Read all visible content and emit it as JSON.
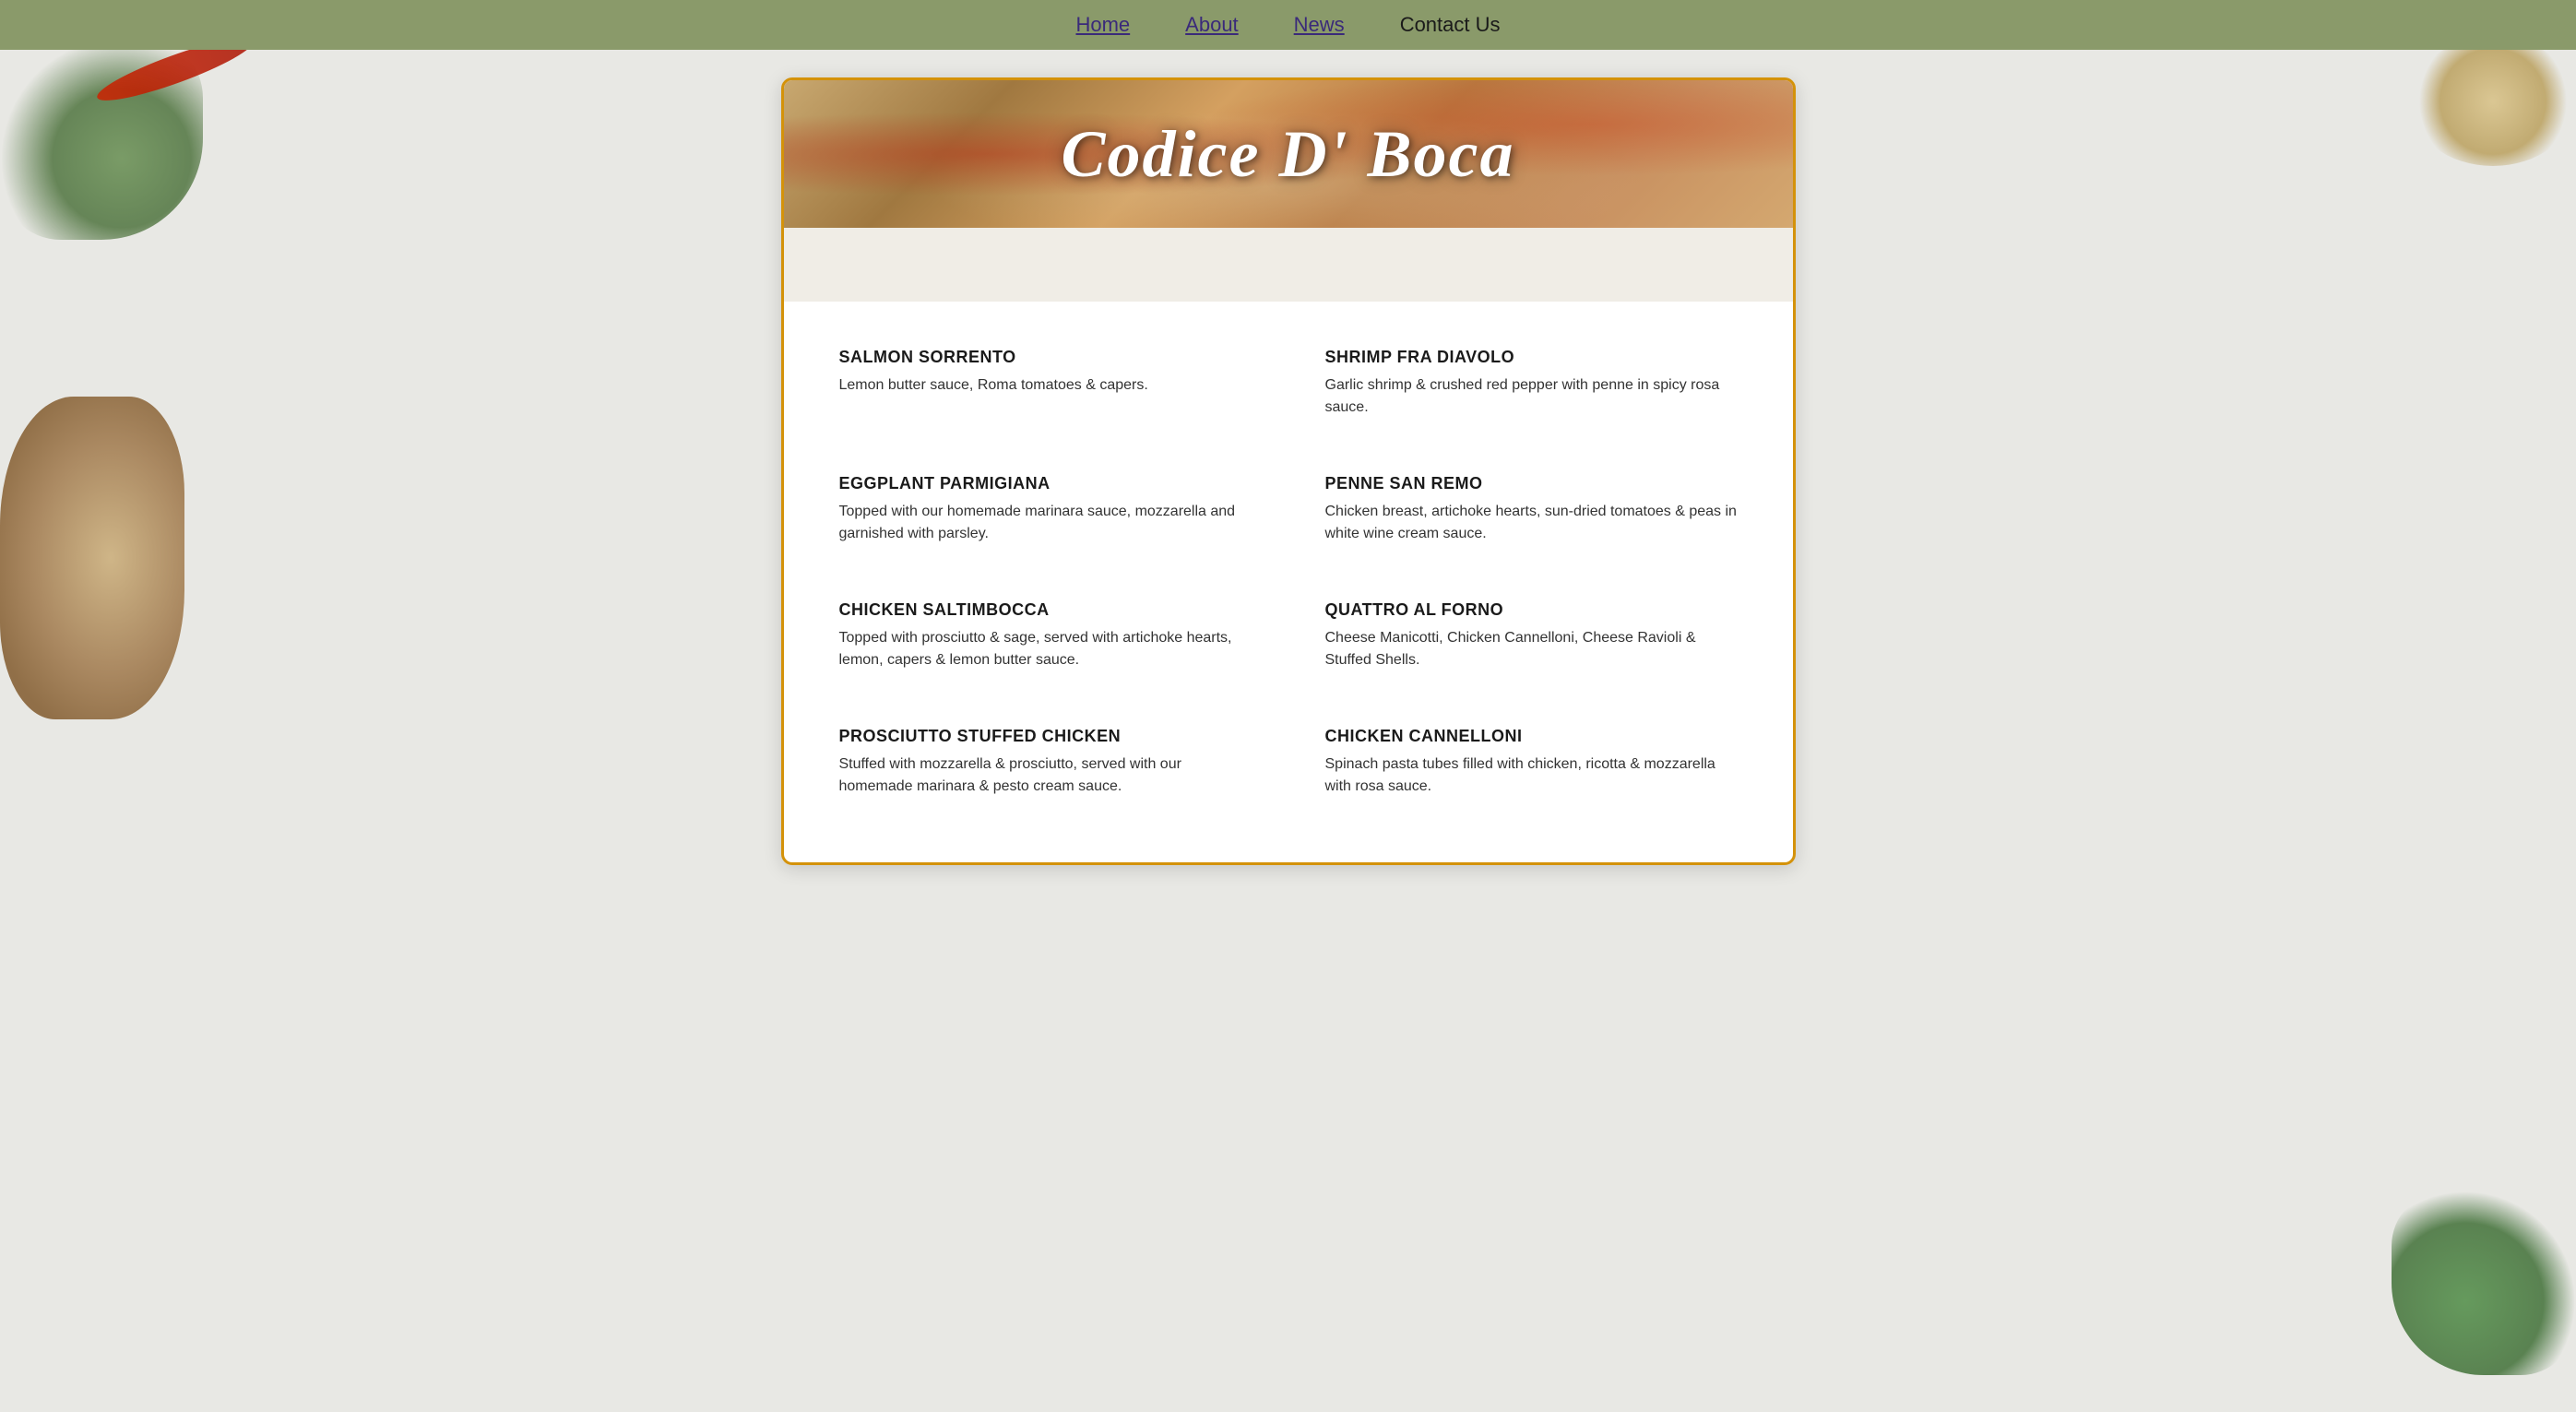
{
  "nav": {
    "items": [
      {
        "label": "Home",
        "href": "#",
        "underline": true
      },
      {
        "label": "About",
        "href": "#",
        "underline": true
      },
      {
        "label": "News",
        "href": "#",
        "underline": true
      },
      {
        "label": "Contact Us",
        "href": "#",
        "underline": false
      }
    ]
  },
  "hero": {
    "title": "Codice D' Boca"
  },
  "menu": {
    "items": [
      {
        "name": "SALMON SORRENTO",
        "description": "Lemon butter sauce, Roma tomatoes & capers."
      },
      {
        "name": "SHRIMP FRA DIAVOLO",
        "description": "Garlic shrimp & crushed red pepper with penne in spicy rosa sauce."
      },
      {
        "name": "EGGPLANT PARMIGIANA",
        "description": "Topped with our homemade marinara sauce, mozzarella and garnished with parsley."
      },
      {
        "name": "PENNE SAN REMO",
        "description": "Chicken breast, artichoke hearts, sun-dried tomatoes & peas in white wine cream sauce."
      },
      {
        "name": "CHICKEN SALTIMBOCCA",
        "description": "Topped with prosciutto & sage, served with artichoke hearts, lemon, capers & lemon butter sauce."
      },
      {
        "name": "QUATTRO AL FORNO",
        "description": "Cheese Manicotti, Chicken Cannelloni, Cheese Ravioli & Stuffed Shells."
      },
      {
        "name": "PROSCIUTTO STUFFED CHICKEN",
        "description": "Stuffed with mozzarella & prosciutto, served with our homemade marinara & pesto cream sauce."
      },
      {
        "name": "CHICKEN CANNELLONI",
        "description": "Spinach pasta tubes filled with chicken, ricotta & mozzarella with rosa sauce."
      }
    ]
  }
}
